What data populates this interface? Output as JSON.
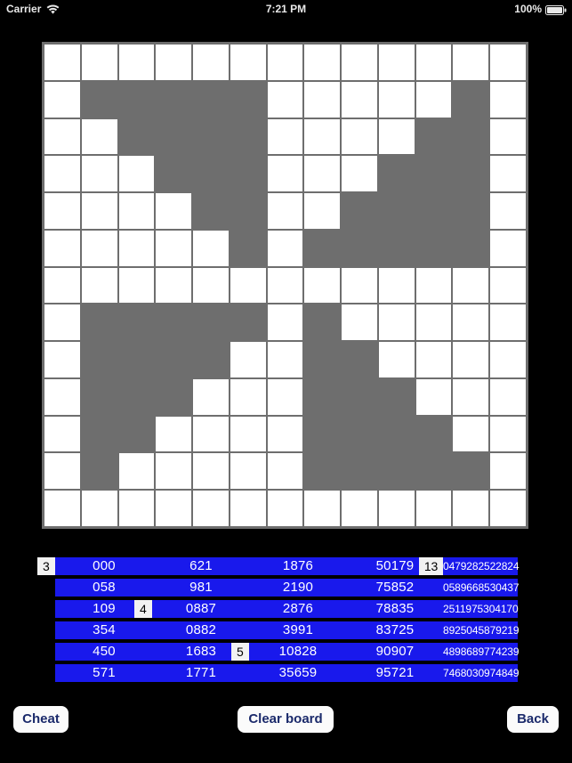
{
  "status_bar": {
    "carrier": "Carrier",
    "wifi_icon": "wifi-icon",
    "time": "7:21 PM",
    "battery_percent": "100%",
    "battery_icon": "battery-icon"
  },
  "board": {
    "rows": 13,
    "cols": 13,
    "cell_empty_color": "#ffffff",
    "cell_filled_color": "#6e6e6e",
    "grid": [
      [
        0,
        0,
        0,
        0,
        0,
        0,
        0,
        0,
        0,
        0,
        0,
        0,
        0
      ],
      [
        0,
        1,
        1,
        1,
        1,
        1,
        0,
        0,
        0,
        0,
        0,
        1,
        0
      ],
      [
        0,
        0,
        1,
        1,
        1,
        1,
        0,
        0,
        0,
        0,
        1,
        1,
        0
      ],
      [
        0,
        0,
        0,
        1,
        1,
        1,
        0,
        0,
        0,
        1,
        1,
        1,
        0
      ],
      [
        0,
        0,
        0,
        0,
        1,
        1,
        0,
        0,
        1,
        1,
        1,
        1,
        0
      ],
      [
        0,
        0,
        0,
        0,
        0,
        1,
        0,
        1,
        1,
        1,
        1,
        1,
        0
      ],
      [
        0,
        0,
        0,
        0,
        0,
        0,
        0,
        0,
        0,
        0,
        0,
        0,
        0
      ],
      [
        0,
        1,
        1,
        1,
        1,
        1,
        0,
        1,
        0,
        0,
        0,
        0,
        0
      ],
      [
        0,
        1,
        1,
        1,
        1,
        0,
        0,
        1,
        1,
        0,
        0,
        0,
        0
      ],
      [
        0,
        1,
        1,
        1,
        0,
        0,
        0,
        1,
        1,
        1,
        0,
        0,
        0
      ],
      [
        0,
        1,
        1,
        0,
        0,
        0,
        0,
        1,
        1,
        1,
        1,
        0,
        0
      ],
      [
        0,
        1,
        0,
        0,
        0,
        0,
        0,
        1,
        1,
        1,
        1,
        1,
        0
      ],
      [
        0,
        0,
        0,
        0,
        0,
        0,
        0,
        0,
        0,
        0,
        0,
        0,
        0
      ]
    ]
  },
  "number_lists": {
    "item_color": "#1919ec",
    "item_text_color": "#ffffff",
    "badge_color": "#f2f2f2",
    "columns": [
      {
        "badge": "3",
        "badge_row": 0,
        "items": [
          "000",
          "058",
          "109",
          "354",
          "450",
          "571"
        ]
      },
      {
        "badge": "4",
        "badge_row": 2,
        "items": [
          "621",
          "981",
          "0887",
          "0882",
          "1683",
          "1771"
        ]
      },
      {
        "badge": "5",
        "badge_row": 4,
        "items": [
          "1876",
          "2190",
          "2876",
          "3991",
          "10828",
          "35659"
        ]
      },
      {
        "badge": null,
        "badge_row": -1,
        "items": [
          "50179",
          "75852",
          "78835",
          "83725",
          "90907",
          "95721"
        ]
      },
      {
        "badge": "13",
        "badge_row": 0,
        "items": [
          "0479282522824",
          "0589668530437",
          "2511975304170",
          "8925045879219",
          "4898689774239",
          "7468030974849"
        ]
      }
    ]
  },
  "buttons": {
    "cheat": "Cheat",
    "clear_board": "Clear board",
    "back": "Back",
    "text_color": "#1b2a6b"
  }
}
